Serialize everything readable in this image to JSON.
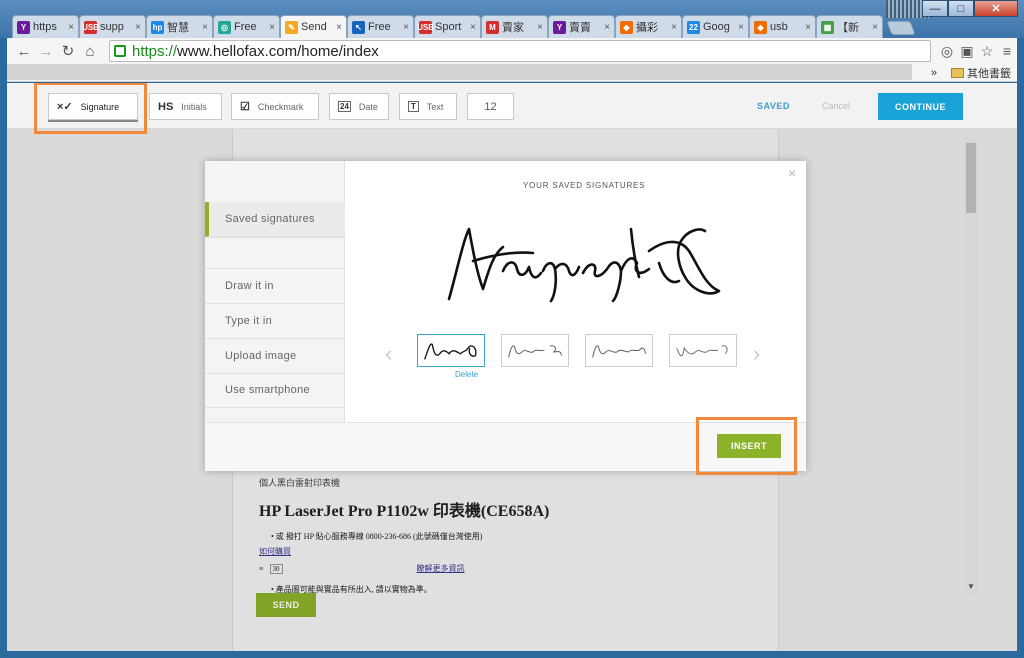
{
  "browser": {
    "tabs": [
      {
        "label": "https",
        "color": "#6a1b9a",
        "glyph": "Y"
      },
      {
        "label": "supp",
        "color": "#d32f2f",
        "glyph": "USB"
      },
      {
        "label": "智慧",
        "color": "#1e88e5",
        "glyph": "hp"
      },
      {
        "label": "Free",
        "color": "#26a69a",
        "glyph": "◎"
      },
      {
        "label": "Send",
        "color": "#f9a825",
        "glyph": "✎"
      },
      {
        "label": "Free",
        "color": "#1565c0",
        "glyph": "↖"
      },
      {
        "label": "Sport",
        "color": "#d32f2f",
        "glyph": "USB"
      },
      {
        "label": "賣家",
        "color": "#d32f2f",
        "glyph": "M"
      },
      {
        "label": "賣賣",
        "color": "#6a1b9a",
        "glyph": "Y"
      },
      {
        "label": "攝彩",
        "color": "#ef6c00",
        "glyph": "◆"
      },
      {
        "label": "Goog",
        "color": "#1e88e5",
        "glyph": "22"
      },
      {
        "label": "usb",
        "color": "#ef6c00",
        "glyph": "◆"
      },
      {
        "label": "【新",
        "color": "#43a047",
        "glyph": "▦"
      }
    ],
    "url_scheme": "https://",
    "url_rest": "www.hellofax.com/home/index",
    "bookmark_overflow": "»",
    "bookmark_folder": "其他書籤"
  },
  "toolbar": {
    "signature_icon": "×✓",
    "signature_label": "Signature",
    "initials_icon": "HS",
    "initials_label": "Initials",
    "checkmark_icon": "☑",
    "checkmark_label": "Checkmark",
    "date_icon": "24",
    "date_label": "Date",
    "text_icon": "T",
    "text_label": "Text",
    "font_size": "12",
    "saved_label": "SAVED",
    "cancel_label": "Cancel",
    "continue_label": "CONTINUE"
  },
  "modal": {
    "title": "YOUR SAVED SIGNATURES",
    "close_glyph": "×",
    "menu": [
      "Saved signatures",
      "Draw it in",
      "Type it in",
      "Upload image",
      "Use smartphone"
    ],
    "delete_label": "Delete",
    "insert_label": "INSERT",
    "prev_glyph": "‹",
    "next_glyph": "›"
  },
  "document": {
    "category": "個人黑白雷射印表機",
    "title": "HP LaserJet Pro P1102w 印表機(CE658A)",
    "bullet1": "• 或 撥打 HP 貼心服務專線 0800-236-686 (此號碼僅台灣使用)",
    "link_how": "如何購買",
    "badge": "30",
    "link_more": "瞭解更多資訊",
    "bullet2": "• 產品圖可能與實品有所出入, 請以實物為準。"
  },
  "send_label": "SEND",
  "window": {
    "min": "—",
    "max": "□",
    "close": "✕"
  }
}
